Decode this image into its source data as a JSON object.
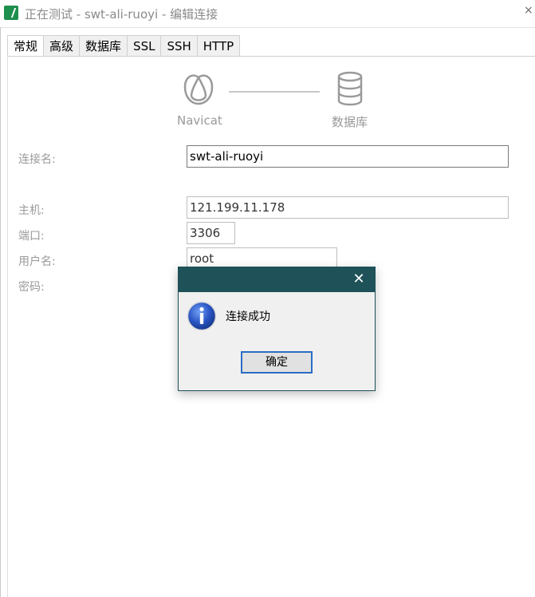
{
  "window": {
    "title": "正在测试 - swt-ali-ruoyi - 编辑连接",
    "close_glyph": "×"
  },
  "tabs": [
    {
      "label": "常规",
      "active": true
    },
    {
      "label": "高级",
      "active": false
    },
    {
      "label": "数据库",
      "active": false
    },
    {
      "label": "SSL",
      "active": false
    },
    {
      "label": "SSH",
      "active": false
    },
    {
      "label": "HTTP",
      "active": false
    }
  ],
  "diagram": {
    "left_label": "Navicat",
    "right_label": "数据库",
    "left_icon": "navicat-logo-icon",
    "right_icon": "database-icon"
  },
  "form": {
    "connection_name_label": "连接名:",
    "connection_name_value": "swt-ali-ruoyi",
    "host_label": "主机:",
    "host_value": "121.199.11.178",
    "port_label": "端口:",
    "port_value": "3306",
    "user_label": "用户名:",
    "user_value": "root",
    "password_label": "密码:"
  },
  "dialog": {
    "message": "连接成功",
    "ok_label": "确定",
    "icon": "info-icon",
    "close_glyph": "✕"
  },
  "colors": {
    "dialog_title_bg": "#1e5158",
    "ok_border": "#2b6cc4",
    "app_icon": "#1f8f4d"
  }
}
